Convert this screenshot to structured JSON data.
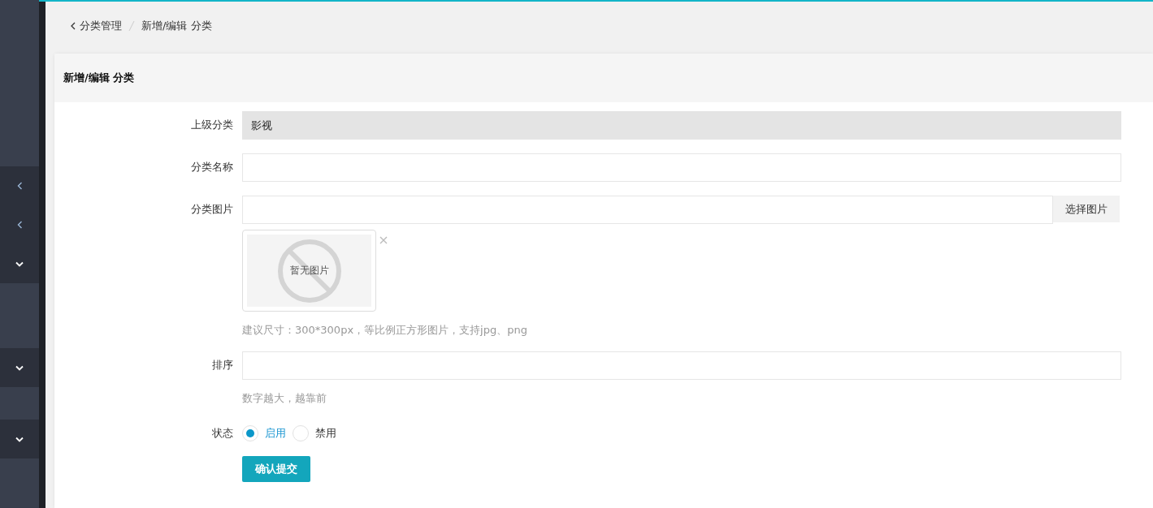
{
  "sidebar": {
    "items": [
      {
        "kind": "panel"
      },
      {
        "kind": "toggle",
        "expanded": false
      },
      {
        "kind": "toggle",
        "expanded": false
      },
      {
        "kind": "toggle",
        "expanded": true
      },
      {
        "kind": "panel"
      },
      {
        "kind": "toggle",
        "expanded": true
      },
      {
        "kind": "panel"
      },
      {
        "kind": "toggle",
        "expanded": true
      },
      {
        "kind": "panel"
      }
    ]
  },
  "breadcrumb": {
    "items": [
      "分类管理",
      "新增/编辑 分类"
    ]
  },
  "card": {
    "title": "新增/编辑 分类"
  },
  "form": {
    "fields": [
      {
        "kind": "readonly",
        "label": "上级分类",
        "value": "影视"
      },
      {
        "kind": "text",
        "label": "分类名称"
      },
      {
        "kind": "image",
        "label": "分类图片",
        "button": "选择图片",
        "no_image_text": "暂无图片",
        "hint": "建议尺寸：300*300px，等比例正方形图片，支持jpg、png"
      },
      {
        "kind": "text",
        "label": "排序",
        "hint": "数字越大，越靠前"
      },
      {
        "kind": "radio",
        "label": "状态",
        "options": [
          {
            "label": "启用",
            "selected": true
          },
          {
            "label": "禁用",
            "selected": false
          }
        ]
      }
    ],
    "submit": "确认提交"
  }
}
